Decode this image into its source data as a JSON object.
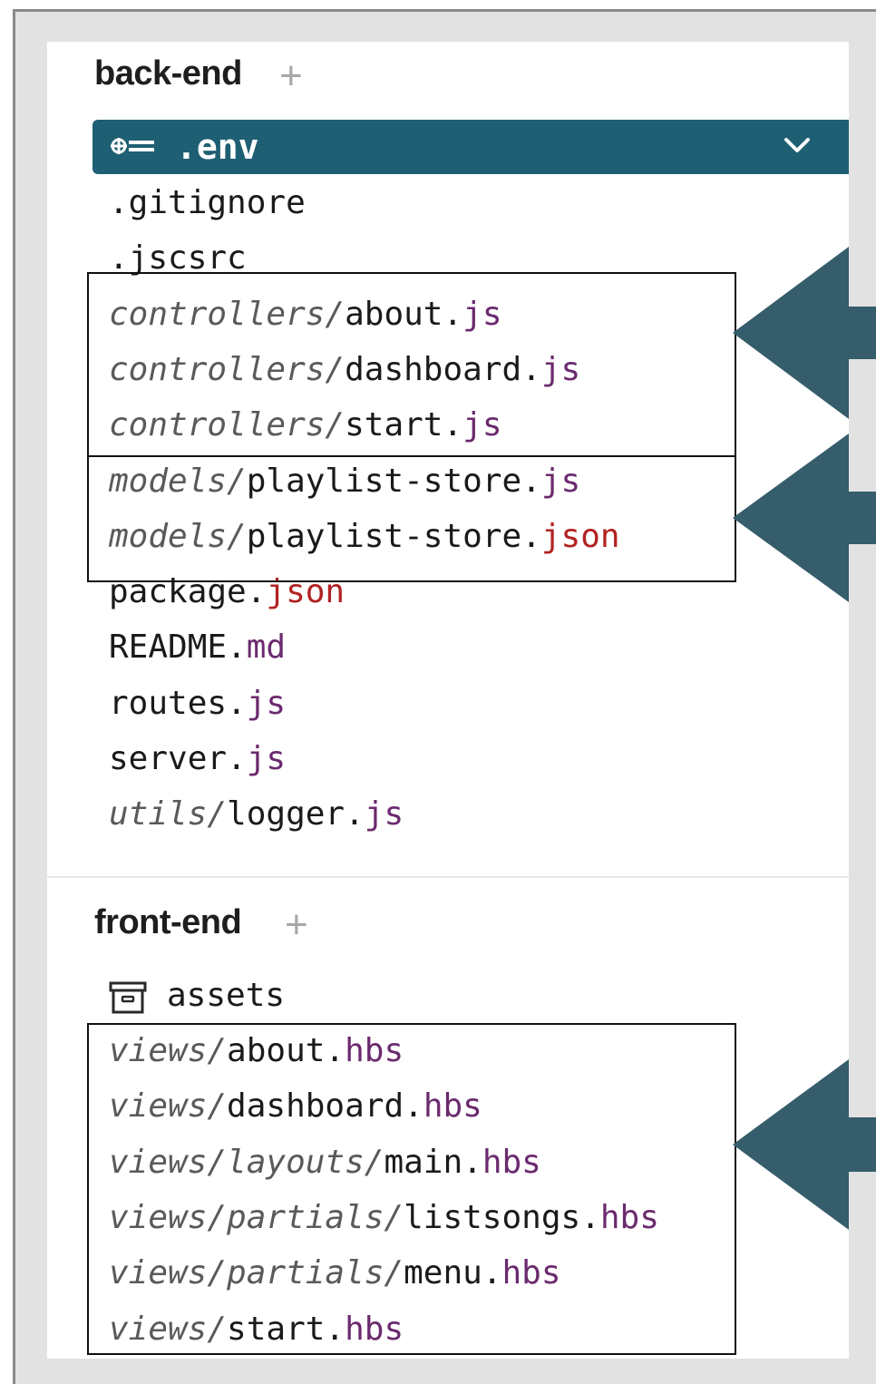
{
  "sections": {
    "backend": {
      "title": "back-end",
      "add": "+"
    },
    "frontend": {
      "title": "front-end",
      "add": "+"
    }
  },
  "selected_file": {
    "name": ".env",
    "icon": "key-icon",
    "toggle_icon": "chevron-down-icon"
  },
  "backend_files": [
    {
      "dir": "",
      "base": ".gitignore",
      "ext": ""
    },
    {
      "dir": "",
      "base": ".jscsrc",
      "ext": ""
    },
    {
      "dir": "controllers/",
      "base": "about",
      "ext": ".js"
    },
    {
      "dir": "controllers/",
      "base": "dashboard",
      "ext": ".js"
    },
    {
      "dir": "controllers/",
      "base": "start",
      "ext": ".js"
    },
    {
      "dir": "models/",
      "base": "playlist-store",
      "ext": ".js"
    },
    {
      "dir": "models/",
      "base": "playlist-store",
      "ext": ".json"
    },
    {
      "dir": "",
      "base": "package",
      "ext": ".json"
    },
    {
      "dir": "",
      "base": "README",
      "ext": ".md"
    },
    {
      "dir": "",
      "base": "routes",
      "ext": ".js"
    },
    {
      "dir": "",
      "base": "server",
      "ext": ".js"
    },
    {
      "dir": "utils/",
      "base": "logger",
      "ext": ".js"
    }
  ],
  "assets_folder": {
    "name": "assets",
    "icon": "archive-box-icon"
  },
  "frontend_files": [
    {
      "dir": "views/",
      "base": "about",
      "ext": ".hbs"
    },
    {
      "dir": "views/",
      "base": "dashboard",
      "ext": ".hbs"
    },
    {
      "dir": "views/layouts/",
      "base": "main",
      "ext": ".hbs"
    },
    {
      "dir": "views/partials/",
      "base": "listsongs",
      "ext": ".hbs"
    },
    {
      "dir": "views/partials/",
      "base": "menu",
      "ext": ".hbs"
    },
    {
      "dir": "views/",
      "base": "start",
      "ext": ".hbs"
    }
  ],
  "colors": {
    "selected_bg": "#1f5f73",
    "arrow": "#355d6b",
    "ext_js": "#6b2a6e",
    "ext_json": "#b22222"
  }
}
